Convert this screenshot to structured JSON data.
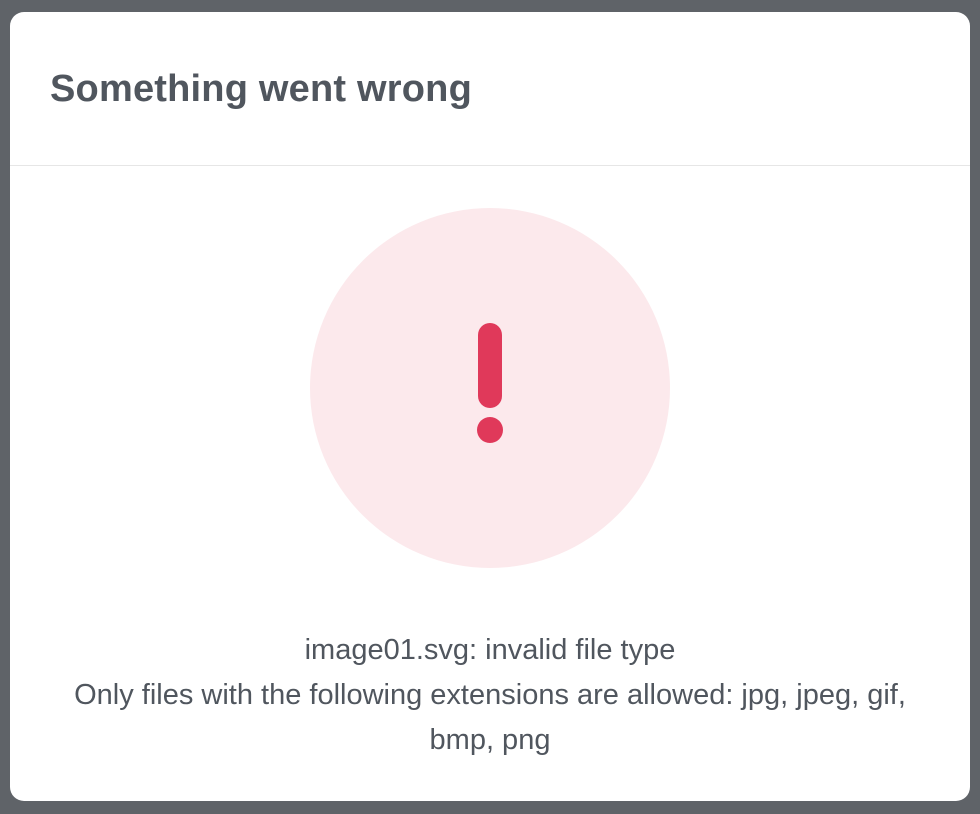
{
  "dialog": {
    "title": "Something went wrong",
    "icon": "exclamation-icon",
    "accent_color": "#e0395a",
    "circle_color": "#fce9ec",
    "error_line": "image01.svg: invalid file type",
    "detail_line": "Only files with the following extensions are allowed: jpg, jpeg, gif, bmp, png"
  }
}
